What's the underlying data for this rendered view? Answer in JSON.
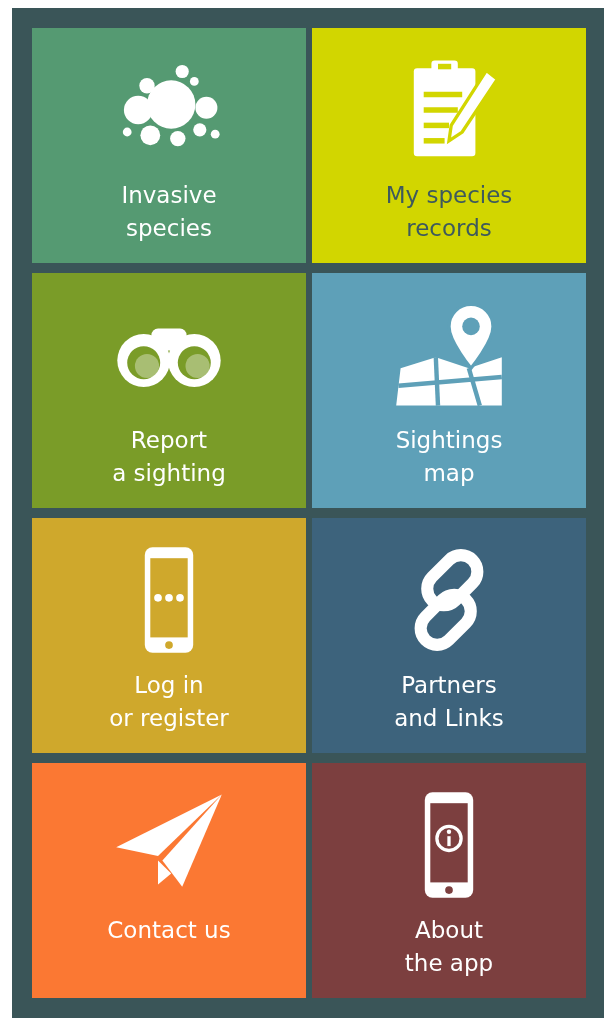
{
  "tiles": [
    {
      "label": "Invasive\nspecies",
      "color": "#559a72"
    },
    {
      "label": "My species\nrecords",
      "color": "#d2d600"
    },
    {
      "label": "Report\na sighting",
      "color": "#7a9c28"
    },
    {
      "label": "Sightings\nmap",
      "color": "#5ea0b8"
    },
    {
      "label": "Log in\nor register",
      "color": "#cfa82c"
    },
    {
      "label": "Partners\nand Links",
      "color": "#3d637c"
    },
    {
      "label": "Contact us",
      "color": "#fb7833"
    },
    {
      "label": "About\nthe app",
      "color": "#7c3f3f"
    }
  ]
}
